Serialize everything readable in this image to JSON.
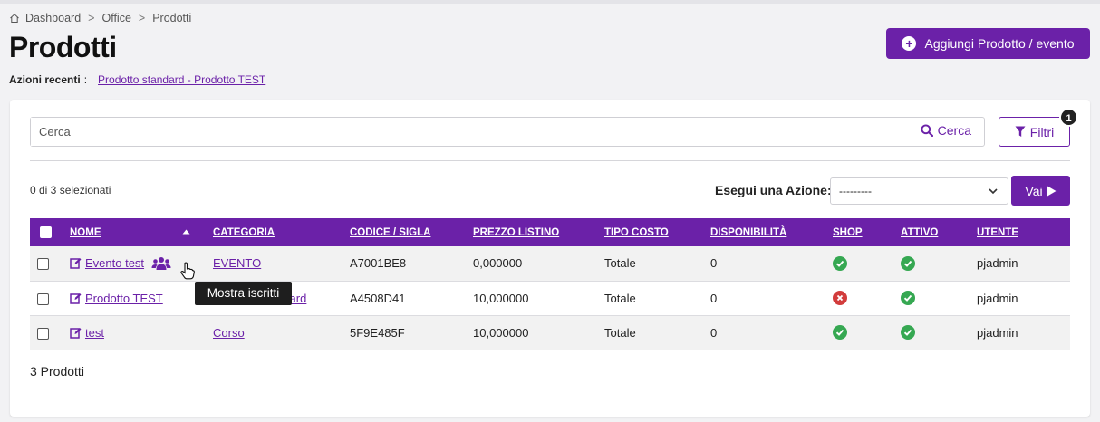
{
  "breadcrumb": [
    "Dashboard",
    "Office",
    "Prodotti"
  ],
  "breadcrumb_sep": ">",
  "page_title": "Prodotti",
  "recent": {
    "label": "Azioni recenti",
    "colon": ":",
    "link": "Prodotto standard - Prodotto TEST"
  },
  "add_button": {
    "label": "Aggiungi Prodotto / evento"
  },
  "search": {
    "placeholder": "Cerca",
    "button_label": "Cerca"
  },
  "filter": {
    "label": "Filtri",
    "badge": "1"
  },
  "selection": {
    "text": "0 di 3 selezionati"
  },
  "action": {
    "label": "Esegui una Azione:",
    "selected": "---------",
    "go_label": "Vai"
  },
  "table": {
    "headers": [
      "NOME",
      "CATEGORIA",
      "CODICE / SIGLA",
      "PREZZO LISTINO",
      "TIPO COSTO",
      "DISPONIBILITÀ",
      "SHOP",
      "ATTIVO",
      "UTENTE"
    ],
    "rows": [
      {
        "name": "Evento test",
        "category": "EVENTO",
        "code": "A7001BE8",
        "price": "0,000000",
        "cost_type": "Totale",
        "availability": "0",
        "shop": true,
        "active": true,
        "user": "pjadmin"
      },
      {
        "name": "Prodotto TEST",
        "category": "Prodotto standard",
        "code": "A4508D41",
        "price": "10,000000",
        "cost_type": "Totale",
        "availability": "0",
        "shop": false,
        "active": true,
        "user": "pjadmin"
      },
      {
        "name": "test",
        "category": "Corso",
        "code": "5F9E485F",
        "price": "10,000000",
        "cost_type": "Totale",
        "availability": "0",
        "shop": true,
        "active": true,
        "user": "pjadmin"
      }
    ]
  },
  "tooltip": "Mostra iscritti",
  "footer": {
    "count": "3 Prodotti"
  },
  "colors": {
    "accent": "#6b21a8",
    "ok": "#36a852",
    "ko": "#d23c3c"
  },
  "icons": [
    "house-icon",
    "plus-circle-icon",
    "search-icon",
    "filter-icon",
    "chevron-down-icon",
    "play-icon",
    "edit-icon",
    "users-icon",
    "hand-cursor-icon",
    "check-circle-icon",
    "x-circle-icon",
    "sort-up-icon"
  ]
}
